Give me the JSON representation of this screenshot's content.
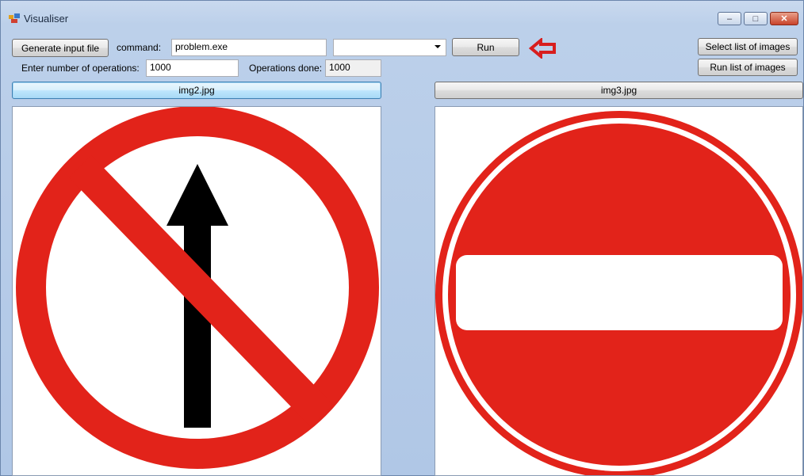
{
  "window": {
    "title": "Visualiser",
    "controls": {
      "minimize": "–",
      "maximize": "□",
      "close": "✕"
    }
  },
  "toolbar": {
    "generate_label": "Generate input file",
    "command_label": "command:",
    "command_value": "problem.exe",
    "combo_value": "",
    "run_label": "Run",
    "select_list_label": "Select list of images",
    "run_list_label": "Run list of images",
    "ops_label": "Enter number of operations:",
    "ops_value": "1000",
    "ops_done_label": "Operations done:",
    "ops_done_value": "1000"
  },
  "left_panel": {
    "header_label": "img2.jpg",
    "image": "no-straight-ahead-sign"
  },
  "right_panel": {
    "header_label": "img3.jpg",
    "image": "no-entry-sign"
  },
  "colors": {
    "sign_red": "#e2231a",
    "annotation_arrow": "#d81e1e",
    "window_bg": "#b9cde8"
  },
  "icons": {
    "annotation": "red-arrow-left-icon"
  }
}
